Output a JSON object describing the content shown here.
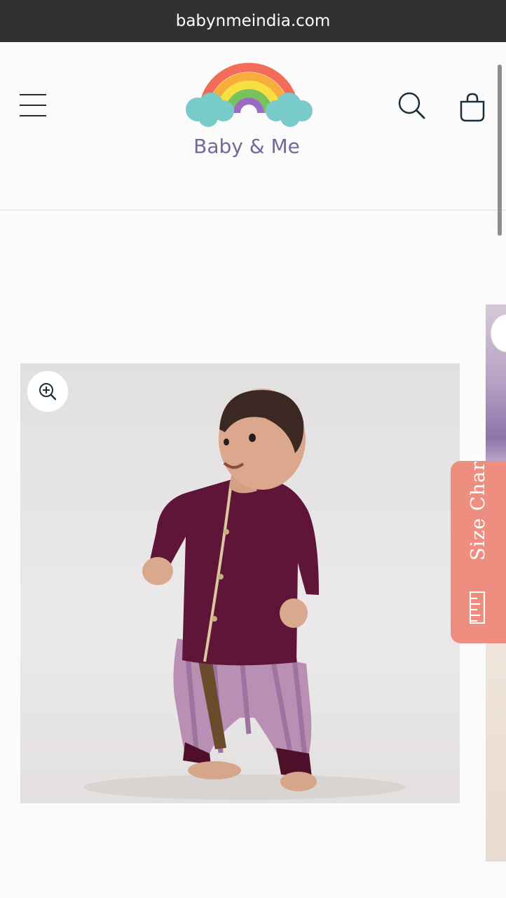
{
  "browser": {
    "url": "babynmeindia.com"
  },
  "header": {
    "logo_text": "Baby & Me",
    "menu_icon": "hamburger-menu-icon",
    "search_icon": "search-icon",
    "cart_icon": "shopping-bag-icon"
  },
  "gallery": {
    "zoom_icon": "zoom-in-icon",
    "main_image_alt": "",
    "size_chart_label": "Size Chart",
    "size_chart_icon": "ruler-icon"
  },
  "colors": {
    "url_bar": "#2f3133",
    "header_icons": "#1d2e3a",
    "logo_text": "#6f6a9c",
    "size_chart_tab": "#ee8e80",
    "kurta": "#5f1537",
    "dhoti": "#b990b4"
  }
}
